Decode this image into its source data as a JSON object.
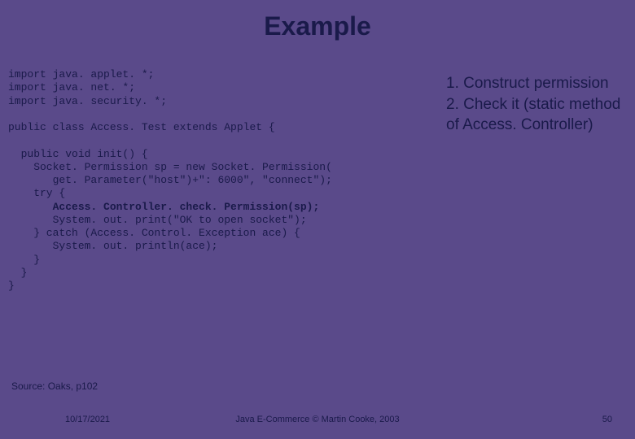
{
  "title": "Example",
  "code": {
    "l1": "import java. applet. *;",
    "l2": "import java. net. *;",
    "l3": "import java. security. *;",
    "l4": "",
    "l5": "public class Access. Test extends Applet {",
    "l6": "",
    "l7": "  public void init() {",
    "l8": "    Socket. Permission sp = new Socket. Permission(",
    "l9": "       get. Parameter(\"host\")+\": 6000\", \"connect\");",
    "l10": "    try {",
    "l11": "       Access. Controller. check. Permission(sp);",
    "l12": "       System. out. print(\"OK to open socket\");",
    "l13": "    } catch (Access. Control. Exception ace) {",
    "l14": "       System. out. println(ace);",
    "l15": "    }",
    "l16": "  }",
    "l17": "}"
  },
  "points": {
    "p1": "1. Construct permission",
    "p2": "2. Check it (static method of Access. Controller)"
  },
  "source": "Source: Oaks, p102",
  "footer": {
    "date": "10/17/2021",
    "center": "Java E-Commerce © Martin Cooke, 2003",
    "page": "50"
  }
}
